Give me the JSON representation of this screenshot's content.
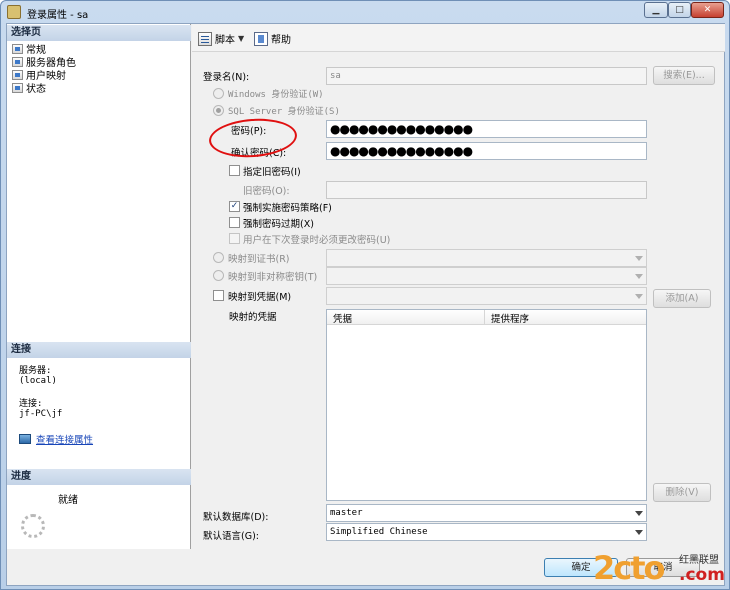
{
  "window": {
    "title": "登录属性 - sa"
  },
  "left": {
    "select_page_header": "选择页",
    "pages": [
      {
        "label": "常规"
      },
      {
        "label": "服务器角色"
      },
      {
        "label": "用户映射"
      },
      {
        "label": "状态"
      }
    ],
    "connection_header": "连接",
    "server_label": "服务器:",
    "server_value": "(local)",
    "connection_label": "连接:",
    "connection_value": "jf-PC\\jf",
    "view_connection_link": "查看连接属性",
    "progress_header": "进度",
    "progress_status": "就绪"
  },
  "toolbar": {
    "script_label": "脚本",
    "help_label": "帮助"
  },
  "form": {
    "login_name_label": "登录名(N):",
    "login_name_value": "sa",
    "search_button": "搜索(E)...",
    "windows_auth": "Windows 身份验证(W)",
    "sql_auth": "SQL Server 身份验证(S)",
    "password_label": "密码(P):",
    "password_value": "●●●●●●●●●●●●●●●",
    "confirm_label": "确认密码(C):",
    "confirm_value": "●●●●●●●●●●●●●●●",
    "specify_old_label": "指定旧密码(I)",
    "old_password_label": "旧密码(O):",
    "enforce_policy_label": "强制实施密码策略(F)",
    "enforce_expiration_label": "强制密码过期(X)",
    "must_change_label": "用户在下次登录时必须更改密码(U)",
    "map_cert_label": "映射到证书(R)",
    "map_asym_label": "映射到非对称密钥(T)",
    "map_cred_label": "映射到凭据(M)",
    "add_button": "添加(A)",
    "mapped_creds_label": "映射的凭据",
    "grid_col_credential": "凭据",
    "grid_col_provider": "提供程序",
    "remove_button": "删除(V)",
    "default_db_label": "默认数据库(D):",
    "default_db_value": "master",
    "default_lang_label": "默认语言(G):",
    "default_lang_value": "Simplified Chinese"
  },
  "footer": {
    "ok_button": "确定",
    "cancel_button": "取消"
  },
  "watermark": {
    "text": "2cto",
    "suffix": ".com",
    "cn": "红黑联盟"
  },
  "colors": {
    "annotation": "#e01010",
    "link": "#1846b8",
    "watermark_orange": "#f0a030"
  }
}
